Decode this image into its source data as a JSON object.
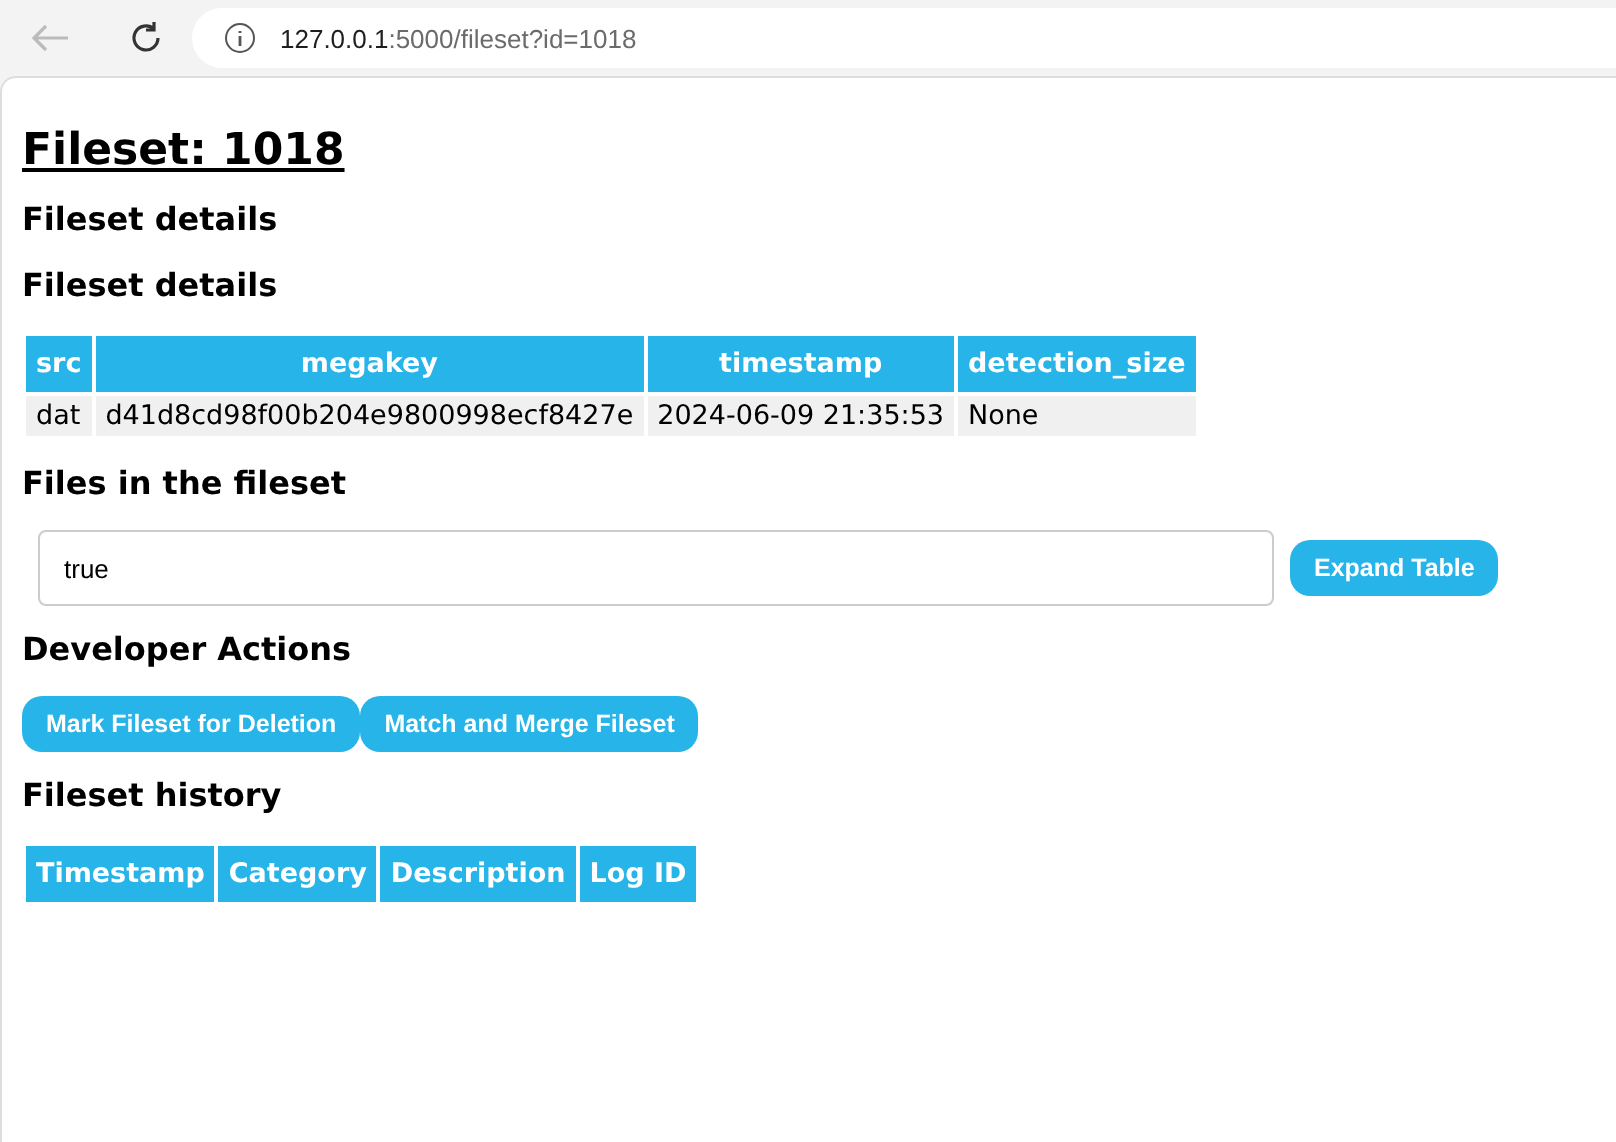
{
  "browser": {
    "host": "127.0.0.1",
    "path": ":5000/fileset?id=1018"
  },
  "title": "Fileset: 1018",
  "sections": [
    {
      "kind": "heading",
      "text": "Fileset details"
    },
    {
      "kind": "table",
      "heading": "Fileset details",
      "columns": [
        "src",
        "megakey",
        "timestamp",
        "detection_size"
      ],
      "rows": [
        [
          "dat",
          "d41d8cd98f00b204e9800998ecf8427e",
          "2024-06-09 21:35:53",
          "None"
        ]
      ]
    },
    {
      "kind": "files",
      "heading": "Files in the fileset",
      "value": "true",
      "button": "Expand Table"
    },
    {
      "kind": "actions",
      "heading": "Developer Actions",
      "buttons": [
        "Mark Fileset for Deletion",
        "Match and Merge Fileset"
      ]
    },
    {
      "kind": "table",
      "heading": "Fileset history",
      "columns": [
        "Timestamp",
        "Category",
        "Description",
        "Log ID"
      ]
    }
  ]
}
